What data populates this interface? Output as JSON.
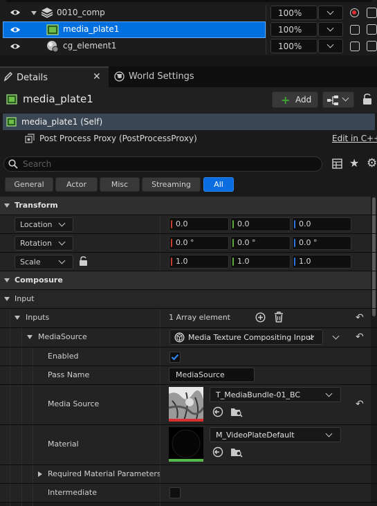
{
  "outliner": {
    "rows": [
      {
        "name": "0010_comp",
        "opacity": "100%"
      },
      {
        "name": "media_plate1",
        "opacity": "100%"
      },
      {
        "name": "cg_element1",
        "opacity": "100%"
      }
    ]
  },
  "tabs": {
    "details": "Details",
    "world_settings": "World Settings"
  },
  "header": {
    "title": "media_plate1",
    "add_label": "Add"
  },
  "components": {
    "self": "media_plate1 (Self)",
    "child": "Post Process Proxy (PostProcessProxy)",
    "edit_link": "Edit in C++"
  },
  "search": {
    "placeholder": "Search"
  },
  "filters": [
    "General",
    "Actor",
    "Misc",
    "Streaming",
    "All"
  ],
  "transform": {
    "section": "Transform",
    "location": {
      "label": "Location",
      "x": "0.0",
      "y": "0.0",
      "z": "0.0"
    },
    "rotation": {
      "label": "Rotation",
      "x": "0.0 °",
      "y": "0.0 °",
      "z": "0.0 °"
    },
    "scale": {
      "label": "Scale",
      "x": "1.0",
      "y": "1.0",
      "z": "1.0"
    }
  },
  "composure": {
    "section": "Composure",
    "input": "Input",
    "inputs_label": "Inputs",
    "inputs_value": "1 Array element",
    "media_source_label": "MediaSource",
    "media_source_class": "Media Texture Compositing Input",
    "enabled_label": "Enabled",
    "pass_name_label": "Pass Name",
    "pass_name_value": "MediaSource",
    "media_source_asset_label": "Media Source",
    "media_source_asset": "T_MediaBundle-01_BC",
    "material_label": "Material",
    "material_asset": "M_VideoPlateDefault",
    "required_params": "Required Material Parameters",
    "intermediate": "Intermediate"
  },
  "colors": {
    "selected": "#0070e0",
    "accent_all": "#0a6ee0",
    "axis_x": "#c9402a",
    "axis_y": "#5fa93a",
    "axis_z": "#2d72d9",
    "add_plus": "#3fa832"
  }
}
